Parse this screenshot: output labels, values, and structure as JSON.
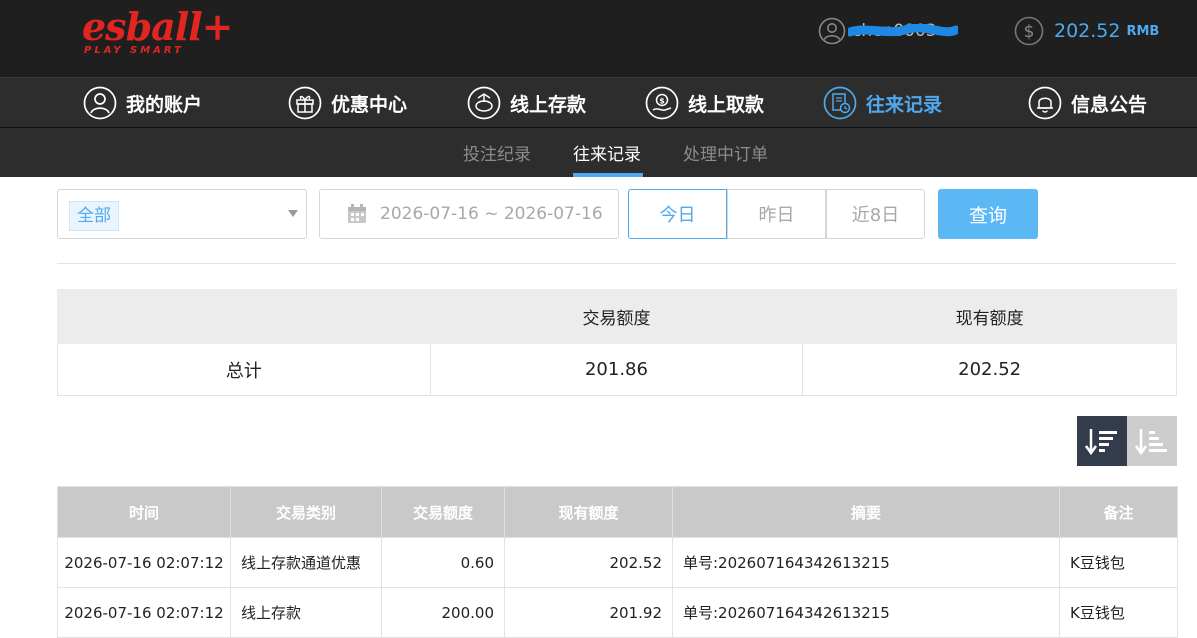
{
  "header": {
    "logo_text": "esball+",
    "logo_tagline": "PLAY SMART",
    "username": "chen0003",
    "balance": "202.52",
    "currency": "RMB"
  },
  "nav": {
    "items": [
      {
        "label": "我的账户",
        "icon": "user-circle-icon"
      },
      {
        "label": "优惠中心",
        "icon": "gift-icon"
      },
      {
        "label": "线上存款",
        "icon": "deposit-icon"
      },
      {
        "label": "线上取款",
        "icon": "withdraw-icon"
      },
      {
        "label": "往来记录",
        "icon": "records-icon",
        "active": true
      },
      {
        "label": "信息公告",
        "icon": "bell-icon"
      }
    ]
  },
  "subnav": {
    "items": [
      {
        "label": "投注纪录"
      },
      {
        "label": "往来记录",
        "active": true
      },
      {
        "label": "处理中订单"
      }
    ]
  },
  "filters": {
    "type_selected": "全部",
    "date_range": "2026-07-16 ~ 2026-07-16",
    "quick": [
      "今日",
      "昨日",
      "近8日"
    ],
    "quick_active": "今日",
    "search_label": "查询"
  },
  "summary": {
    "headers": [
      "",
      "交易额度",
      "现有额度"
    ],
    "row": [
      "总计",
      "201.86",
      "202.52"
    ]
  },
  "records": {
    "headers": [
      "时间",
      "交易类别",
      "交易额度",
      "现有额度",
      "摘要",
      "备注"
    ],
    "rows": [
      [
        "2026-07-16 02:07:12",
        "线上存款通道优惠",
        "0.60",
        "202.52",
        "单号:202607164342613215",
        "K豆钱包"
      ],
      [
        "2026-07-16 02:07:12",
        "线上存款",
        "200.00",
        "201.92",
        "单号:202607164342613215",
        "K豆钱包"
      ]
    ]
  },
  "colors": {
    "accent": "#4ea9ee",
    "brand_red": "#e32521",
    "topbar_bg": "#1f1f1f",
    "nav_bg": "#2d2d2d"
  }
}
